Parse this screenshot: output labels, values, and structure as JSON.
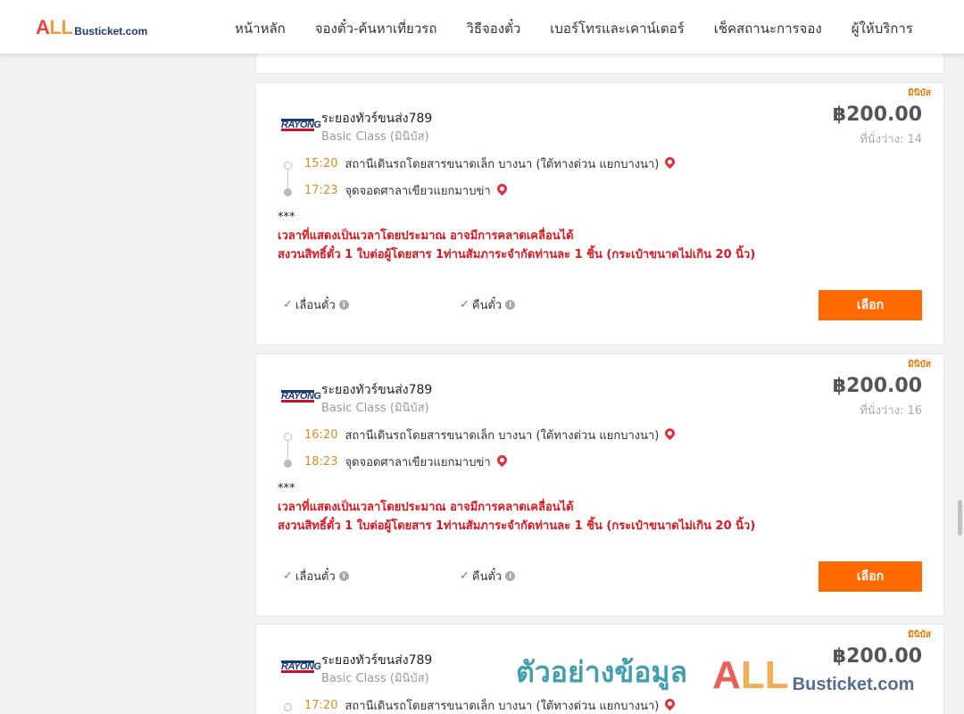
{
  "header": {
    "logo": {
      "all_a": "A",
      "all_l": "LL",
      "site": "Busticket.com"
    },
    "nav": [
      {
        "label": "หน้าหลัก"
      },
      {
        "label": "จองตั๋ว-ค้นหาเที่ยวรถ"
      },
      {
        "label": "วิธีจองตั๋ว"
      },
      {
        "label": "เบอร์โทรและเคาน์เตอร์"
      },
      {
        "label": "เช็คสถานะการจอง"
      },
      {
        "label": "ผู้ให้บริการ"
      }
    ]
  },
  "trips": [
    {
      "badge": "มินิบัส",
      "operator_logo": "RAYONG",
      "operator": "ระยองทัวร์ขนส่ง789",
      "class": "Basic Class (มินิบัส)",
      "price": "฿200.00",
      "seats": "ที่นั่งว่าง: 14",
      "departure_time": "15:20",
      "departure_place": "สถานีเดินรถโดยสารขนาดเล็ก บางนา (ใต้ทางด่วน แยกบางนา)",
      "arrival_time": "17:23",
      "arrival_place": "จุดจอดศาลาเขียวแยกมาบข่า",
      "note_stars": "***",
      "note_line1": "เวลาที่แสดงเป็นเวลาโดยประมาณ อาจมีการคลาดเคลื่อนได้",
      "note_line2": "สงวนสิทธิ์ตั๋ว 1 ใบต่อผู้โดยสาร 1ท่านสัมภาระจำกัดท่านละ 1 ชิ้น (กระเป๋าขนาดไม่เกิน 20 นิ้ว)",
      "feature1": "เลื่อนตั๋ว",
      "feature2": "คืนตั๋ว",
      "select_label": "เลือก"
    },
    {
      "badge": "มินิบัส",
      "operator_logo": "RAYONG",
      "operator": "ระยองทัวร์ขนส่ง789",
      "class": "Basic Class (มินิบัส)",
      "price": "฿200.00",
      "seats": "ที่นั่งว่าง: 16",
      "departure_time": "16:20",
      "departure_place": "สถานีเดินรถโดยสารขนาดเล็ก บางนา (ใต้ทางด่วน แยกบางนา)",
      "arrival_time": "18:23",
      "arrival_place": "จุดจอดศาลาเขียวแยกมาบข่า",
      "note_stars": "***",
      "note_line1": "เวลาที่แสดงเป็นเวลาโดยประมาณ อาจมีการคลาดเคลื่อนได้",
      "note_line2": "สงวนสิทธิ์ตั๋ว 1 ใบต่อผู้โดยสาร 1ท่านสัมภาระจำกัดท่านละ 1 ชิ้น (กระเป๋าขนาดไม่เกิน 20 นิ้ว)",
      "feature1": "เลื่อนตั๋ว",
      "feature2": "คืนตั๋ว",
      "select_label": "เลือก"
    },
    {
      "badge": "มินิบัส",
      "operator_logo": "RAYONG",
      "operator": "ระยองทัวร์ขนส่ง789",
      "class": "Basic Class (มินิบัส)",
      "price": "฿200.00",
      "departure_time": "17:20",
      "departure_place": "สถานีเดินรถโดยสารขนาดเล็ก บางนา (ใต้ทางด่วน แยกบางนา)"
    }
  ],
  "watermark": {
    "text": "ตัวอย่างข้อมูล",
    "all_a": "A",
    "all_l": "LL",
    "site": "Busticket.com"
  },
  "colors": {
    "accent": "#ff6a00",
    "warning": "#e0161f",
    "time": "#e48c1a",
    "badge": "#e47a00"
  }
}
